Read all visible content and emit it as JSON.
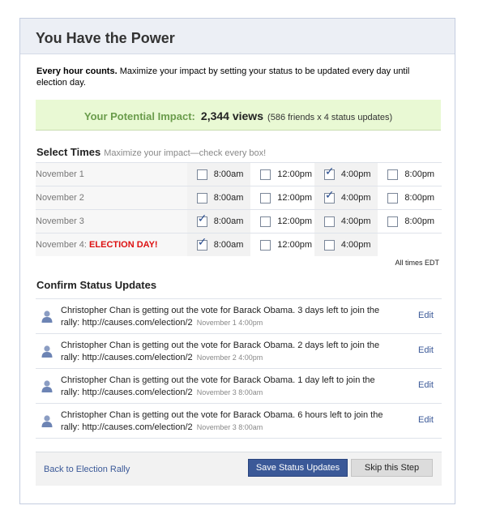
{
  "dialog": {
    "title": "You Have the Power"
  },
  "intro": {
    "bold": "Every hour counts.",
    "text": " Maximize your impact by setting your status to be updated every day until election day."
  },
  "impact": {
    "label": "Your Potential Impact:",
    "views": "2,344 views",
    "detail": "(586 friends x 4 status updates)"
  },
  "select_times": {
    "title": "Select Times",
    "subtitle": "Maximize your impact—check every box!",
    "rows": [
      {
        "day": "November 1",
        "highlight": "",
        "slots": [
          {
            "time": "8:00am",
            "checked": false
          },
          {
            "time": "12:00pm",
            "checked": false
          },
          {
            "time": "4:00pm",
            "checked": true
          },
          {
            "time": "8:00pm",
            "checked": false
          }
        ]
      },
      {
        "day": "November 2",
        "highlight": "",
        "slots": [
          {
            "time": "8:00am",
            "checked": false
          },
          {
            "time": "12:00pm",
            "checked": false
          },
          {
            "time": "4:00pm",
            "checked": true
          },
          {
            "time": "8:00pm",
            "checked": false
          }
        ]
      },
      {
        "day": "November 3",
        "highlight": "",
        "slots": [
          {
            "time": "8:00am",
            "checked": true
          },
          {
            "time": "12:00pm",
            "checked": false
          },
          {
            "time": "4:00pm",
            "checked": false
          },
          {
            "time": "8:00pm",
            "checked": false
          }
        ]
      },
      {
        "day": "November 4:",
        "highlight": "ELECTION DAY!",
        "slots": [
          {
            "time": "8:00am",
            "checked": true
          },
          {
            "time": "12:00pm",
            "checked": false
          },
          {
            "time": "4:00pm",
            "checked": false
          }
        ]
      }
    ],
    "timezone_note": "All times EDT"
  },
  "confirm": {
    "title": "Confirm Status Updates",
    "edit_label": "Edit",
    "updates": [
      {
        "text": "Christopher Chan is getting out the vote for Barack Obama. 3 days left to join the rally: http://causes.com/election/2",
        "time": "November 1 4:00pm"
      },
      {
        "text": "Christopher Chan is getting out the vote for Barack Obama. 2 days left to join the rally: http://causes.com/election/2",
        "time": "November 2 4:00pm"
      },
      {
        "text": "Christopher Chan is getting out the vote for Barack Obama. 1 day left to join the rally: http://causes.com/election/2",
        "time": "November 3 8:00am"
      },
      {
        "text": "Christopher Chan is getting out the vote for Barack Obama. 6 hours left to join the rally: http://causes.com/election/2",
        "time": "November 3 8:00am"
      }
    ]
  },
  "footer": {
    "back_link": "Back to Election Rally",
    "save_label": "Save Status Updates",
    "skip_label": "Skip this Step"
  },
  "colors": {
    "link": "#3b5998",
    "impact_bg": "#e9f9d4",
    "election_day": "#dd1111"
  }
}
